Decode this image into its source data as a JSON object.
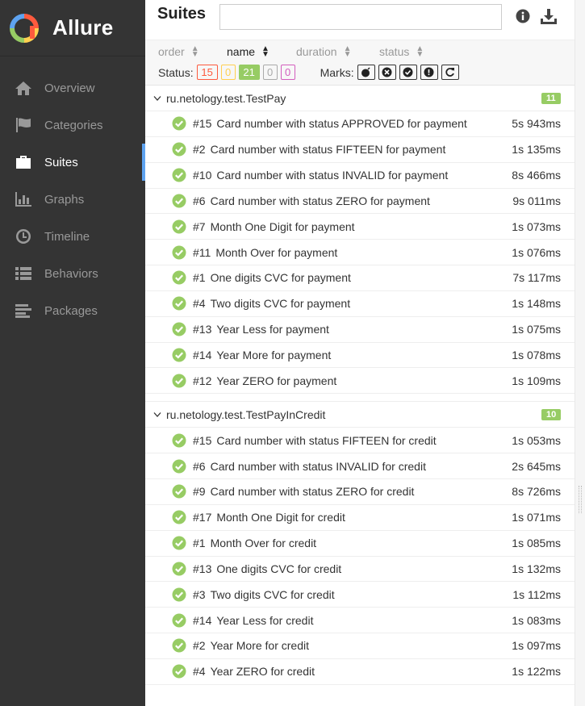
{
  "brand": {
    "name": "Allure"
  },
  "sidebar": {
    "items": [
      {
        "label": "Overview",
        "icon": "home-icon"
      },
      {
        "label": "Categories",
        "icon": "flag-icon"
      },
      {
        "label": "Suites",
        "icon": "briefcase-icon",
        "active": true
      },
      {
        "label": "Graphs",
        "icon": "bar-chart-icon"
      },
      {
        "label": "Timeline",
        "icon": "clock-icon"
      },
      {
        "label": "Behaviors",
        "icon": "list-icon"
      },
      {
        "label": "Packages",
        "icon": "align-left-icon"
      }
    ]
  },
  "header": {
    "title": "Suites",
    "search": {
      "value": "",
      "placeholder": ""
    }
  },
  "sort": {
    "order": "order",
    "name": "name",
    "duration": "duration",
    "status": "status"
  },
  "status_filter": {
    "label": "Status:",
    "failed": "15",
    "broken": "0",
    "passed": "21",
    "skipped": "0",
    "unknown": "0"
  },
  "marks": {
    "label": "Marks:"
  },
  "colors": {
    "passed": "#97cc64",
    "failed": "#fd5a3e",
    "broken": "#ffd050",
    "skipped": "#aaaaaa",
    "unknown": "#d35ebe",
    "sidebar_bg": "#343434",
    "active_accent": "#5ea3f0"
  },
  "groups": [
    {
      "name": "ru.netology.test.TestPay",
      "count": "11",
      "tests": [
        {
          "num": "#15",
          "name": "Card number with status APPROVED for payment",
          "duration": "5s 943ms"
        },
        {
          "num": "#2",
          "name": "Card number with status FIFTEEN for payment",
          "duration": "1s 135ms"
        },
        {
          "num": "#10",
          "name": "Card number with status INVALID for payment",
          "duration": "8s 466ms"
        },
        {
          "num": "#6",
          "name": "Card number with status ZERO for payment",
          "duration": "9s 011ms"
        },
        {
          "num": "#7",
          "name": "Month One Digit for payment",
          "duration": "1s 073ms"
        },
        {
          "num": "#11",
          "name": "Month Over for payment",
          "duration": "1s 076ms"
        },
        {
          "num": "#1",
          "name": "One digits CVC for payment",
          "duration": "7s 117ms"
        },
        {
          "num": "#4",
          "name": "Two digits CVC for payment",
          "duration": "1s 148ms"
        },
        {
          "num": "#13",
          "name": "Year Less for payment",
          "duration": "1s 075ms"
        },
        {
          "num": "#14",
          "name": "Year More for payment",
          "duration": "1s 078ms"
        },
        {
          "num": "#12",
          "name": "Year ZERO for payment",
          "duration": "1s 109ms"
        }
      ]
    },
    {
      "name": "ru.netology.test.TestPayInCredit",
      "count": "10",
      "tests": [
        {
          "num": "#15",
          "name": "Card number with status FIFTEEN for credit",
          "duration": "1s 053ms"
        },
        {
          "num": "#6",
          "name": "Card number with status INVALID for credit",
          "duration": "2s 645ms"
        },
        {
          "num": "#9",
          "name": "Card number with status ZERO for credit",
          "duration": "8s 726ms"
        },
        {
          "num": "#17",
          "name": "Month One Digit for credit",
          "duration": "1s 071ms"
        },
        {
          "num": "#1",
          "name": "Month Over for credit",
          "duration": "1s 085ms"
        },
        {
          "num": "#13",
          "name": "One digits CVC for credit",
          "duration": "1s 132ms"
        },
        {
          "num": "#3",
          "name": "Two digits CVC for credit",
          "duration": "1s 112ms"
        },
        {
          "num": "#14",
          "name": "Year Less for credit",
          "duration": "1s 083ms"
        },
        {
          "num": "#2",
          "name": "Year More for credit",
          "duration": "1s 097ms"
        },
        {
          "num": "#4",
          "name": "Year ZERO for credit",
          "duration": "1s 122ms"
        }
      ]
    }
  ]
}
